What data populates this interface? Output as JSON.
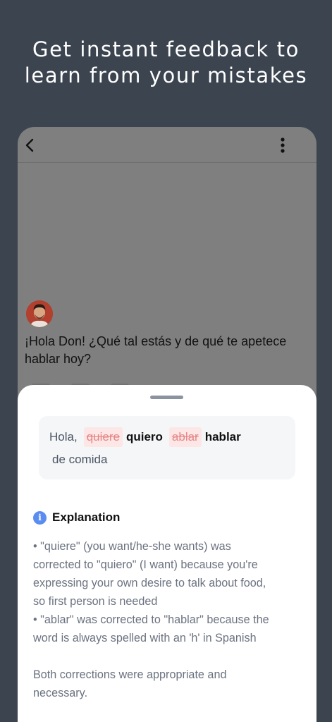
{
  "headline": {
    "line1": "Get instant feedback to",
    "line2": "learn from your mistakes"
  },
  "chat": {
    "back_icon": "chevron-left-icon",
    "menu_icon": "kebab-menu-icon",
    "message": "¡Hola Don! ¿Qué tal estás y de qué te apetece hablar hoy?"
  },
  "correction": {
    "prefix": "Hola,",
    "wrong_1": "quiere",
    "right_1": "quiero",
    "wrong_2": "ablar",
    "right_2": "hablar",
    "suffix": "de comida",
    "colors": {
      "wrong_text": "#e58585",
      "wrong_bg": "#fde6e6"
    }
  },
  "explanation": {
    "icon": "info-icon",
    "icon_glyph": "i",
    "title": "Explanation",
    "lines": [
      "• \"quiere\" (you want/he-she wants) was",
      "corrected to \"quiero\" (I want) because you're",
      "expressing your own desire to talk about food,",
      "so first person is needed",
      "• \"ablar\" was corrected to \"hablar\" because the",
      "word is always spelled with an 'h' in Spanish"
    ],
    "closing_lines": [
      "Both corrections were appropriate and",
      "necessary."
    ],
    "accent_color": "#5b8df0"
  }
}
